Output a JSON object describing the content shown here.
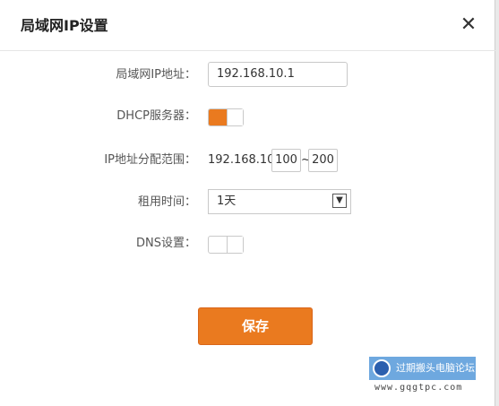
{
  "dialog": {
    "title": "局域网IP设置",
    "close_symbol": "✕"
  },
  "form": {
    "lan_ip": {
      "label": "局域网IP地址：",
      "value": "192.168.10.1"
    },
    "dhcp": {
      "label": "DHCP服务器：",
      "state": "on"
    },
    "ip_range": {
      "label": "IP地址分配范围：",
      "prefix": "192.168.10.",
      "start": "100",
      "separator": "~",
      "end": "200"
    },
    "lease_time": {
      "label": "租用时间：",
      "selected": "1天"
    },
    "dns": {
      "label": "DNS设置：",
      "state": "off"
    }
  },
  "actions": {
    "save_label": "保存"
  },
  "watermark": {
    "brand": "过期搬头电脑论坛",
    "url": "www.gqgtpc.com"
  },
  "colors": {
    "accent": "#ea7a1f"
  }
}
